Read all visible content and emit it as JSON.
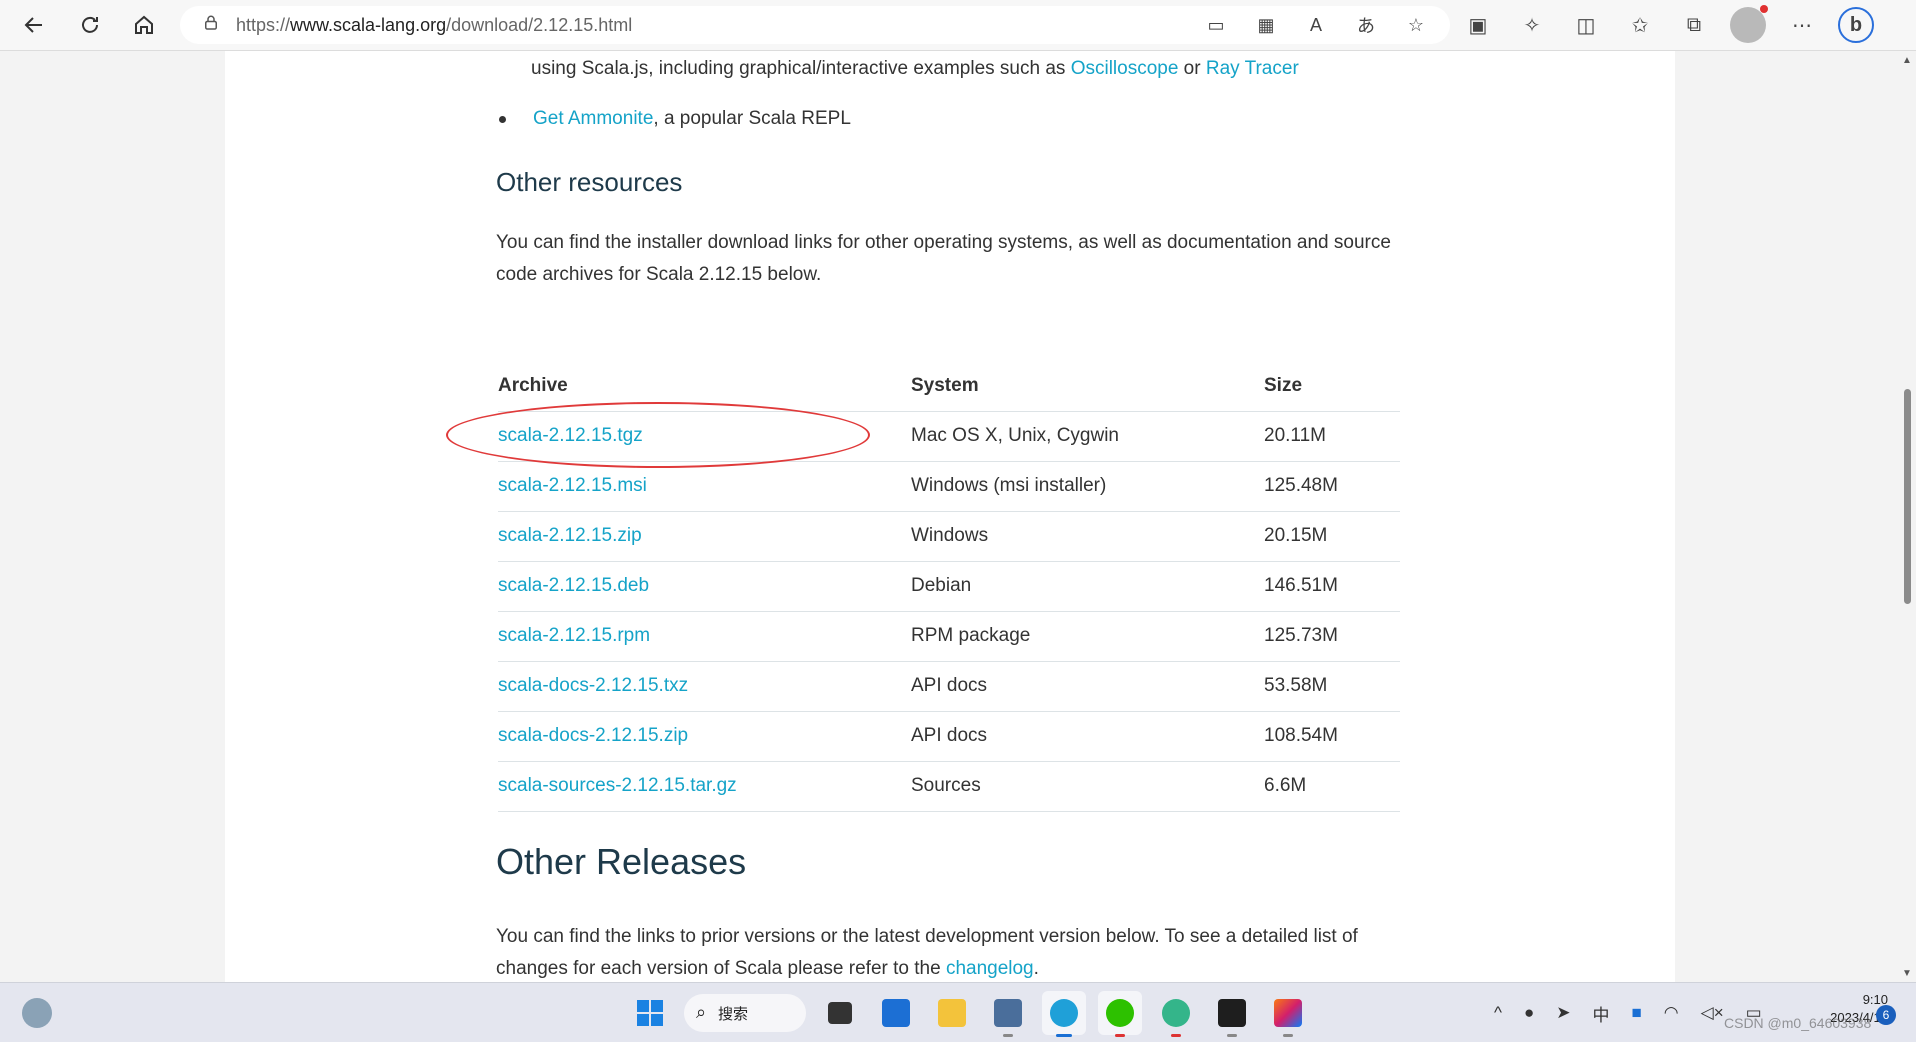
{
  "browser": {
    "url_prefix": "https://",
    "url_host": "www.scala-lang.org",
    "url_path": "/download/2.12.15.html"
  },
  "page": {
    "bullet_top_text": "using Scala.js, including graphical/interactive examples such as ",
    "bullet_top_link1": "Oscilloscope",
    "bullet_top_or": " or ",
    "bullet_top_link2": "Ray Tracer",
    "bullet2_link": "Get Ammonite",
    "bullet2_text": ", a popular Scala REPL",
    "other_resources_heading": "Other resources",
    "other_resources_text": "You can find the installer download links for other operating systems, as well as documentation and source code archives for Scala 2.12.15 below.",
    "table": {
      "headers": [
        "Archive",
        "System",
        "Size"
      ],
      "rows": [
        {
          "archive": "scala-2.12.15.tgz",
          "system": "Mac OS X, Unix, Cygwin",
          "size": "20.11M"
        },
        {
          "archive": "scala-2.12.15.msi",
          "system": "Windows (msi installer)",
          "size": "125.48M"
        },
        {
          "archive": "scala-2.12.15.zip",
          "system": "Windows",
          "size": "20.15M"
        },
        {
          "archive": "scala-2.12.15.deb",
          "system": "Debian",
          "size": "146.51M"
        },
        {
          "archive": "scala-2.12.15.rpm",
          "system": "RPM package",
          "size": "125.73M"
        },
        {
          "archive": "scala-docs-2.12.15.txz",
          "system": "API docs",
          "size": "53.58M"
        },
        {
          "archive": "scala-docs-2.12.15.zip",
          "system": "API docs",
          "size": "108.54M"
        },
        {
          "archive": "scala-sources-2.12.15.tar.gz",
          "system": "Sources",
          "size": "6.6M"
        }
      ]
    },
    "other_releases_heading": "Other Releases",
    "other_releases_text": "You can find the links to prior versions or the latest development version below. To see a detailed list of changes for each version of Scala please refer to the ",
    "changelog_link": "changelog",
    "period": "."
  },
  "taskbar": {
    "search_label": "搜索",
    "time": "9:10",
    "date": "2023/4/13",
    "notification_count": "6",
    "watermark": "CSDN @m0_64603938",
    "ime_label": "中"
  },
  "colors": {
    "link": "#15a3c8",
    "annotation_circle": "#e03a3a"
  }
}
